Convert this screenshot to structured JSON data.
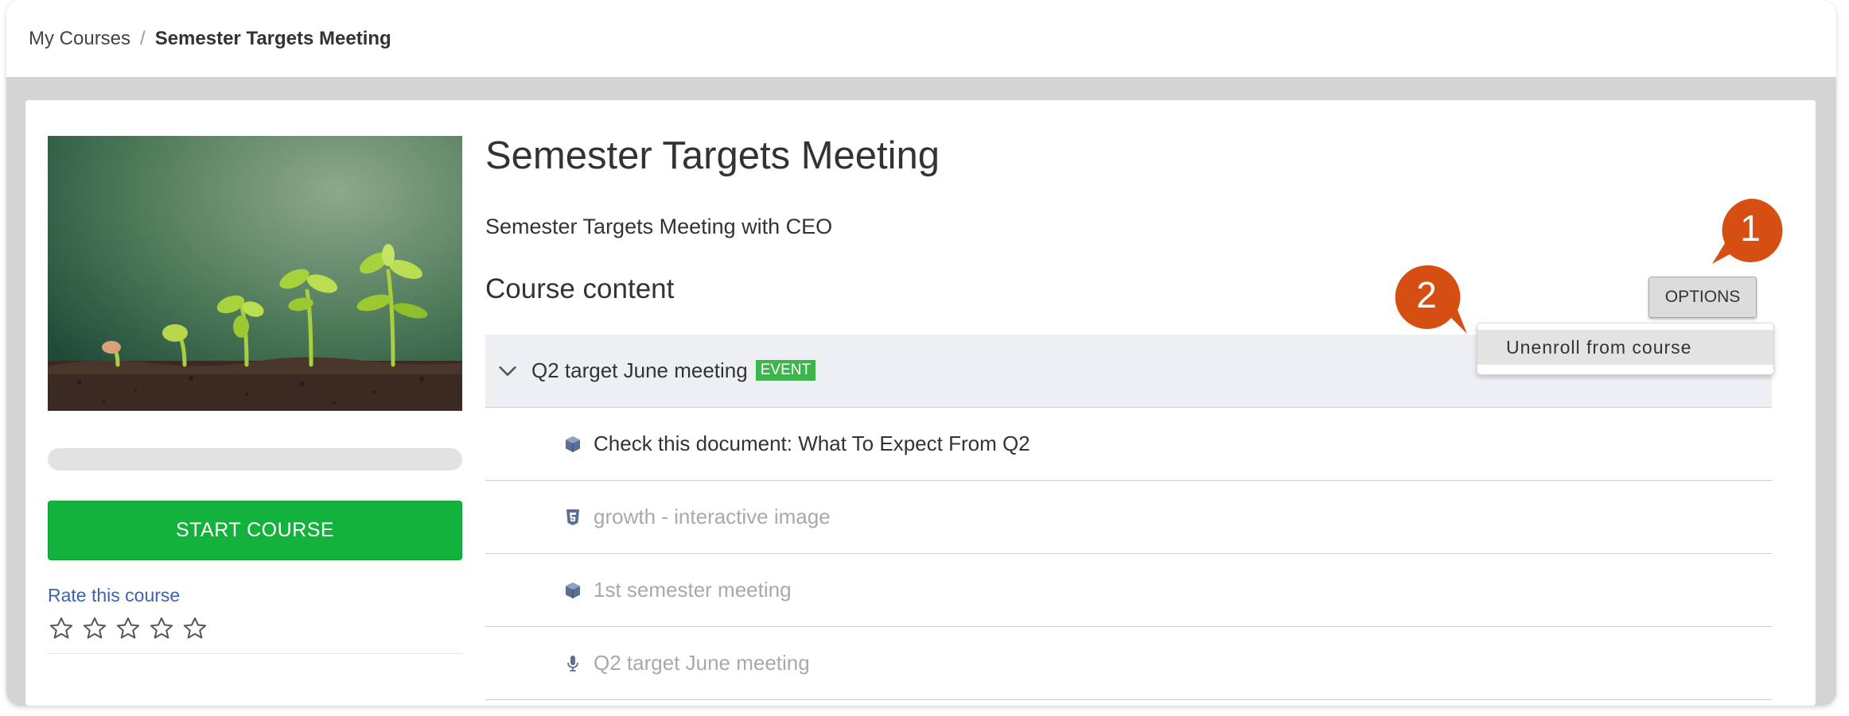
{
  "breadcrumb": {
    "parent": "My Courses",
    "separator": "/",
    "current": "Semester Targets Meeting"
  },
  "course": {
    "title": "Semester Targets Meeting",
    "description": "Semester Targets Meeting with CEO",
    "progress_percent": 0,
    "start_button": "START COURSE",
    "rate_label": "Rate this course",
    "rating_stars": 0
  },
  "content": {
    "heading": "Course content",
    "options_button": "OPTIONS",
    "group": {
      "title": "Q2 target June meeting",
      "badge": "EVENT"
    },
    "items": [
      {
        "icon": "package-icon",
        "title": "Check this document: What To Expect From Q2",
        "state": "active"
      },
      {
        "icon": "html5-icon",
        "title": "growth - interactive image",
        "state": "muted"
      },
      {
        "icon": "package-icon",
        "title": "1st semester meeting",
        "state": "muted"
      },
      {
        "icon": "microphone-icon",
        "title": "Q2 target June meeting",
        "state": "muted"
      }
    ]
  },
  "options_menu": {
    "items": [
      "Unenroll from course"
    ]
  },
  "callouts": [
    "1",
    "2"
  ],
  "colors": {
    "accent_green": "#13b23c",
    "badge_green": "#3cb54a",
    "link_blue": "#3b63b8",
    "callout_orange": "#d64f12"
  }
}
